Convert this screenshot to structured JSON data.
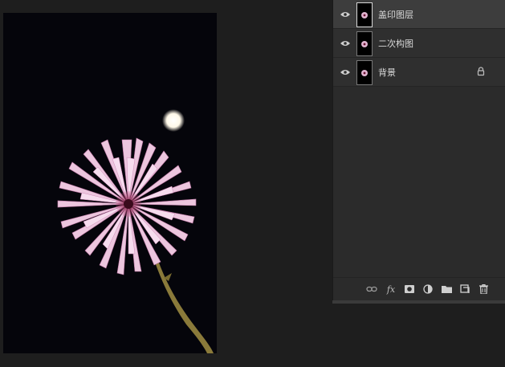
{
  "layers_panel": {
    "layers": [
      {
        "name": "盖印图层",
        "selected": true,
        "locked": false,
        "visible": true,
        "thumb_icon": "flower-thumbnail"
      },
      {
        "name": "二次构图",
        "selected": false,
        "locked": false,
        "visible": true,
        "thumb_icon": "flower-thumbnail"
      },
      {
        "name": "背景",
        "selected": false,
        "locked": true,
        "visible": true,
        "thumb_icon": "flower-thumbnail"
      }
    ],
    "footer_buttons": [
      {
        "name": "link-layers-icon"
      },
      {
        "name": "fx-icon",
        "label": "fx"
      },
      {
        "name": "layer-mask-icon"
      },
      {
        "name": "adjustment-layer-icon"
      },
      {
        "name": "new-group-icon"
      },
      {
        "name": "new-layer-icon"
      },
      {
        "name": "delete-layer-icon"
      }
    ]
  },
  "colors": {
    "workspace_bg": "#1e1e1e",
    "panel_bg": "#2b2b2b",
    "selected_row": "#3d3d3d",
    "petal_pink": "#e8b9d9",
    "stem": "#8a7a3a"
  }
}
